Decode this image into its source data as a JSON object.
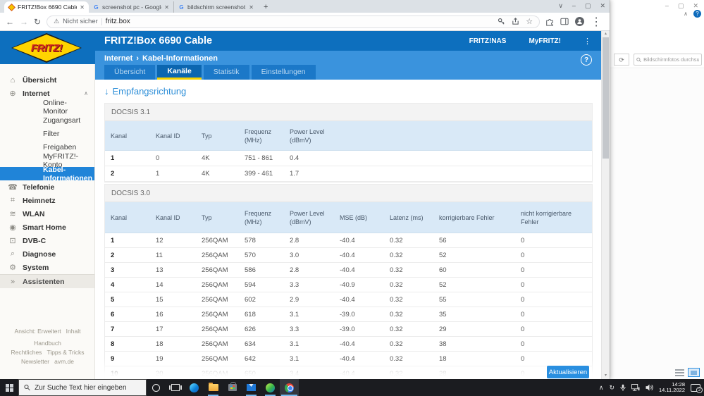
{
  "icons": {
    "close": "✕",
    "minimize": "–",
    "maximize": "▢",
    "chevron_down": "∨",
    "chevron_up": "∧",
    "back": "←",
    "forward": "→",
    "reload": "↻",
    "kebab": "⋮",
    "star": "☆",
    "warning": "⚠",
    "new_tab": "+",
    "scroll_up": "▴",
    "scroll_down": "▾",
    "help": "?",
    "heading_arrow": "↓",
    "breadcrumb_sep": "›",
    "refresh": "⟳",
    "tray_sync": "↻"
  },
  "browser": {
    "tabs": [
      {
        "title": "FRITZ!Box 6690 Cable",
        "favicon": "fav-fritz",
        "fav_char": "",
        "cls": "active"
      },
      {
        "title": "screenshot pc - Google Suche",
        "favicon": "fav-google",
        "fav_char": "G",
        "cls": ""
      },
      {
        "title": "bildschirm screenshot erstellen -",
        "favicon": "fav-google",
        "fav_char": "G",
        "cls": "sep"
      }
    ],
    "address": {
      "security": "Nicht sicher",
      "url": "fritz.box"
    }
  },
  "fritz": {
    "title": "FRITZ!Box 6690 Cable",
    "logo_text": "FRITZ!",
    "nav_links": [
      "FRITZ!NAS",
      "MyFRITZ!"
    ],
    "breadcrumb": {
      "section": "Internet",
      "page": "Kabel-Informationen"
    },
    "tabs": [
      {
        "label": "Übersicht",
        "cls": ""
      },
      {
        "label": "Kanäle",
        "cls": "active"
      },
      {
        "label": "Statistik",
        "cls": ""
      },
      {
        "label": "Einstellungen",
        "cls": ""
      }
    ],
    "sidebar": {
      "items": [
        {
          "label": "Übersicht",
          "glyph": "⌂",
          "cls": "top",
          "chevron": ""
        },
        {
          "label": "Internet",
          "glyph": "⊕",
          "cls": "top",
          "chevron": "∧"
        },
        {
          "label": "Online-Monitor",
          "glyph": "",
          "cls": "sub",
          "chevron": ""
        },
        {
          "label": "Zugangsart",
          "glyph": "",
          "cls": "sub",
          "chevron": ""
        },
        {
          "label": "Filter",
          "glyph": "",
          "cls": "sub",
          "chevron": ""
        },
        {
          "label": "Freigaben",
          "glyph": "",
          "cls": "sub",
          "chevron": ""
        },
        {
          "label": "MyFRITZ!-Konto",
          "glyph": "",
          "cls": "sub",
          "chevron": ""
        },
        {
          "label": "Kabel-Informationen",
          "glyph": "",
          "cls": "sub active",
          "chevron": ""
        },
        {
          "label": "Telefonie",
          "glyph": "☎",
          "cls": "top",
          "chevron": ""
        },
        {
          "label": "Heimnetz",
          "glyph": "⌗",
          "cls": "top",
          "chevron": ""
        },
        {
          "label": "WLAN",
          "glyph": "≋",
          "cls": "top",
          "chevron": ""
        },
        {
          "label": "Smart Home",
          "glyph": "◉",
          "cls": "top",
          "chevron": ""
        },
        {
          "label": "DVB-C",
          "glyph": "⊡",
          "cls": "top",
          "chevron": ""
        },
        {
          "label": "Diagnose",
          "glyph": "⌕",
          "cls": "top",
          "chevron": ""
        },
        {
          "label": "System",
          "glyph": "⚙",
          "cls": "top",
          "chevron": ""
        },
        {
          "label": "Assistenten",
          "glyph": "»",
          "cls": "top assist",
          "chevron": ""
        }
      ]
    },
    "heading": "Empfangsrichtung",
    "docsis31": {
      "title": "DOCSIS 3.1",
      "columns": [
        "Kanal",
        "Kanal ID",
        "Typ",
        "Frequenz (MHz)",
        "Power Level\n(dBmV)"
      ],
      "rows": [
        [
          "1",
          "0",
          "4K",
          "751 - 861",
          "0.4"
        ],
        [
          "2",
          "1",
          "4K",
          "399 - 461",
          "1.7"
        ]
      ]
    },
    "docsis30": {
      "title": "DOCSIS 3.0",
      "columns": [
        "Kanal",
        "Kanal ID",
        "Typ",
        "Frequenz (MHz)",
        "Power Level\n(dBmV)",
        "MSE (dB)",
        "Latenz (ms)",
        "korrigierbare Fehler",
        "nicht korrigierbare Fehler"
      ],
      "rows": [
        [
          "1",
          "12",
          "256QAM",
          "578",
          "2.8",
          "-40.4",
          "0.32",
          "56",
          "0"
        ],
        [
          "2",
          "11",
          "256QAM",
          "570",
          "3.0",
          "-40.4",
          "0.32",
          "52",
          "0"
        ],
        [
          "3",
          "13",
          "256QAM",
          "586",
          "2.8",
          "-40.4",
          "0.32",
          "60",
          "0"
        ],
        [
          "4",
          "14",
          "256QAM",
          "594",
          "3.3",
          "-40.9",
          "0.32",
          "52",
          "0"
        ],
        [
          "5",
          "15",
          "256QAM",
          "602",
          "2.9",
          "-40.4",
          "0.32",
          "55",
          "0"
        ],
        [
          "6",
          "16",
          "256QAM",
          "618",
          "3.1",
          "-39.0",
          "0.32",
          "35",
          "0"
        ],
        [
          "7",
          "17",
          "256QAM",
          "626",
          "3.3",
          "-39.0",
          "0.32",
          "29",
          "0"
        ],
        [
          "8",
          "18",
          "256QAM",
          "634",
          "3.1",
          "-40.4",
          "0.32",
          "38",
          "0"
        ],
        [
          "9",
          "19",
          "256QAM",
          "642",
          "3.1",
          "-40.4",
          "0.32",
          "18",
          "0"
        ],
        [
          "10",
          "20",
          "256QAM",
          "650",
          "3.4",
          "-40.4",
          "0.32",
          "28",
          "0"
        ]
      ]
    },
    "update_button": "Aktualisieren",
    "footer": {
      "row1": [
        "Ansicht: Erweitert",
        "Inhalt",
        "Handbuch"
      ],
      "row2": [
        "Rechtliches",
        "Tipps & Tricks"
      ],
      "row3": [
        "Newsletter",
        "avm.de"
      ]
    }
  },
  "photos": {
    "search_placeholder": "Bildschirmfotos durchsuchen"
  },
  "taskbar": {
    "search_placeholder": "Zur Suche Text hier eingeben",
    "time": "14:28",
    "date": "14.11.2022",
    "notification_count": "2"
  }
}
